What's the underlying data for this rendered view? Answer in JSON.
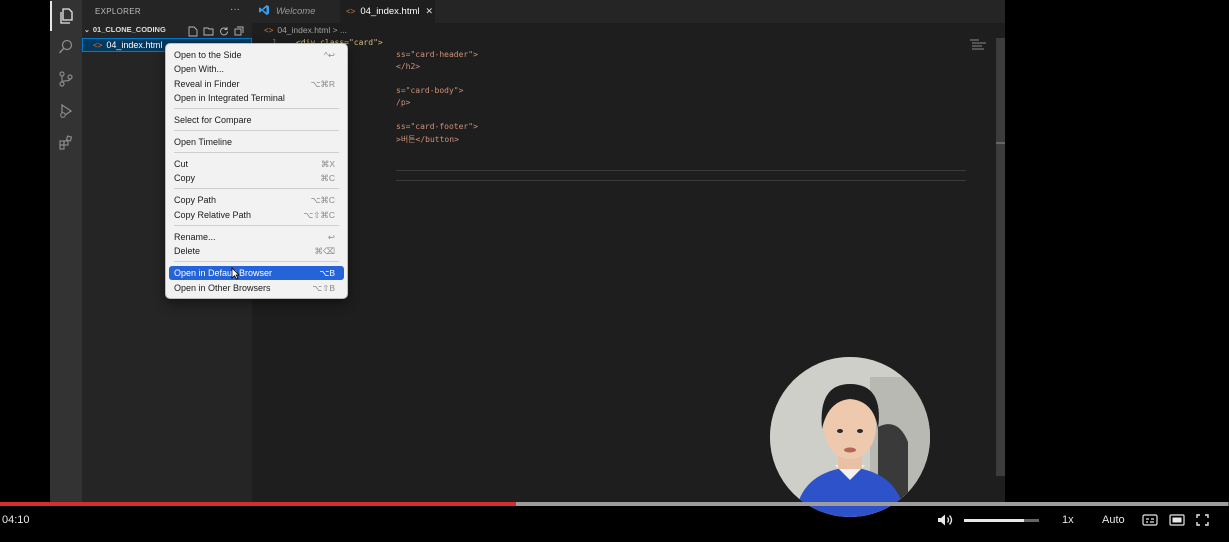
{
  "explorer": {
    "header": "EXPLORER",
    "more": "···",
    "folder": "01_CLONE_CODING",
    "file": "04_index.html"
  },
  "tabs": [
    {
      "label": "Welcome"
    },
    {
      "label": "04_index.html",
      "close": "✕"
    }
  ],
  "breadcrumb": "04_index.html > ...",
  "code": {
    "line1_no": "1",
    "line1": "<div class=\"card\">",
    "line2": "ss=\"card-header\">",
    "line3": "</h2>",
    "line4": "s=\"card-body\">",
    "line5": "/p>",
    "line6": "ss=\"card-footer\">",
    "line7": ">버튼</button>"
  },
  "context_menu": {
    "items": [
      {
        "label": "Open to the Side",
        "shortcut": "^↩"
      },
      {
        "label": "Open With...",
        "shortcut": ""
      },
      {
        "label": "Reveal in Finder",
        "shortcut": "⌥⌘R"
      },
      {
        "label": "Open in Integrated Terminal",
        "shortcut": ""
      },
      {
        "label": "Select for Compare",
        "shortcut": ""
      },
      {
        "label": "Open Timeline",
        "shortcut": ""
      },
      {
        "label": "Cut",
        "shortcut": "⌘X"
      },
      {
        "label": "Copy",
        "shortcut": "⌘C"
      },
      {
        "label": "Copy Path",
        "shortcut": "⌥⌘C"
      },
      {
        "label": "Copy Relative Path",
        "shortcut": "⌥⇧⌘C"
      },
      {
        "label": "Rename...",
        "shortcut": "↩"
      },
      {
        "label": "Delete",
        "shortcut": "⌘⌫"
      },
      {
        "label": "Open in Default Browser",
        "shortcut": "⌥B"
      },
      {
        "label": "Open in Other Browsers",
        "shortcut": "⌥⇧B"
      }
    ]
  },
  "video": {
    "time": "04:10",
    "speed": "1x",
    "quality": "Auto",
    "progress_fraction": 0.42,
    "buffer_fraction": 0.999,
    "volume_fraction": 0.8
  },
  "colors": {
    "progress": "#d62e2e",
    "menu_highlight": "#2563d8",
    "vscode_accent": "#007acc"
  }
}
